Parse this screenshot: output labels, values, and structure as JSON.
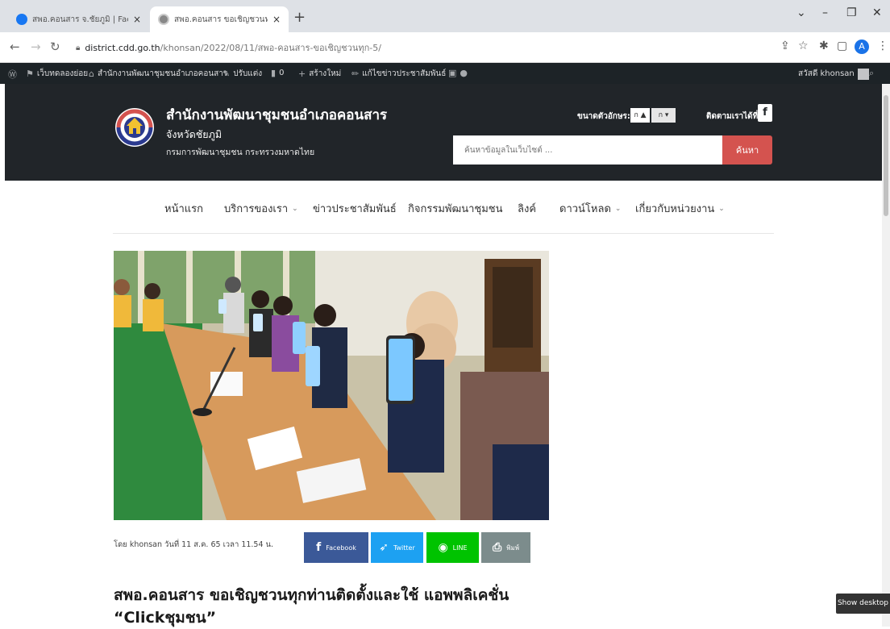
{
  "browser": {
    "tabs": [
      {
        "title": "สพอ.คอนสาร จ.ชัยภูมิ | Facebook",
        "close": "×"
      },
      {
        "title": "สพอ.คอนสาร ขอเชิญชวนทุกท่านติดตั้ง",
        "close": "×"
      }
    ],
    "new_tab": "+",
    "url_host": "district.cdd.go.th",
    "url_path": "/khonsan/2022/08/11/สพอ-คอนสาร-ขอเชิญชวนทุก-5/",
    "profile_initial": "A"
  },
  "adminbar": {
    "items": [
      "เว็บทดลองย่อย",
      "สำนักงานพัฒนาชุมชนอำเภอคอนสาร",
      "ปรับแต่ง",
      "0",
      "สร้างใหม่",
      "แก้ไขข่าวประชาสัมพันธ์"
    ],
    "greeting": "สวัสดี khonsan"
  },
  "header": {
    "title": "สำนักงานพัฒนาชุมชนอำเภอคอนสาร",
    "subtitle": "จังหวัดชัยภูมิ",
    "ministry": "กรมการพัฒนาชุมชน กระทรวงมหาดไทย",
    "font_size_label": "ขนาดตัวอักษร:",
    "font_up": "ก ▲",
    "font_down": "ก ▾",
    "follow_label": "ติดตามเราได้ที่:",
    "facebook_glyph": "f",
    "search_placeholder": "ค้นหาข้อมูลในเว็บไซต์ ...",
    "search_button": "ค้นหา"
  },
  "nav": {
    "items": [
      {
        "label": "หน้าแรก",
        "dropdown": false
      },
      {
        "label": "บริการของเรา",
        "dropdown": true
      },
      {
        "label": "ข่าวประชาสัมพันธ์",
        "dropdown": false
      },
      {
        "label": "กิจกรรมพัฒนาชุมชน",
        "dropdown": false
      },
      {
        "label": "ลิงค์",
        "dropdown": false
      },
      {
        "label": "ดาวน์โหลด",
        "dropdown": true
      },
      {
        "label": "เกี่ยวกับหน่วยงาน",
        "dropdown": true
      }
    ],
    "chevron": "⌄"
  },
  "post": {
    "meta": "โดย khonsan วันที่ 11 ส.ค. 65 เวลา 11.54 น.",
    "share": {
      "facebook": "Facebook",
      "twitter": "Twitter",
      "line": "LINE",
      "print": "พิมพ์"
    },
    "title_line1": "สพอ.คอนสาร ขอเชิญชวนทุกท่านติดตั้งและใช้ แอพพลิเคชั่น",
    "title_line2": "“Clickชุมชน”"
  },
  "toast": "Show desktop",
  "colors": {
    "header_bg": "#212529",
    "search_button": "#d4534f",
    "facebook": "#3b5998",
    "twitter": "#1da1f2",
    "line": "#00c300",
    "print": "#7c8c8c"
  }
}
